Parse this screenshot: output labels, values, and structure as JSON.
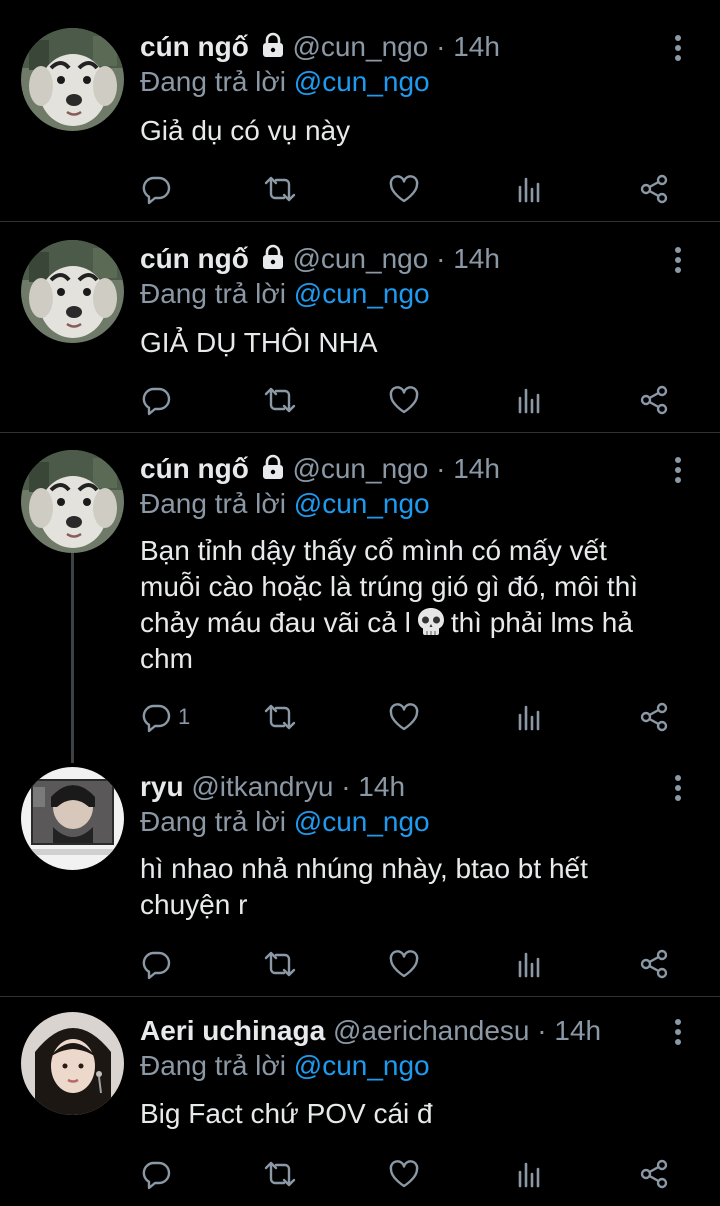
{
  "tweets": [
    {
      "name": "cún ngố",
      "handle": "@cun_ngo",
      "separator": "·",
      "time": "14h",
      "reply_label": "Đang trả lời",
      "reply_mention": "@cun_ngo",
      "text": "Giả dụ có vụ này",
      "reply_count": "",
      "avatar": "dog-avatar",
      "locked": true
    },
    {
      "name": "cún ngố",
      "handle": "@cun_ngo",
      "separator": "·",
      "time": "14h",
      "reply_label": "Đang trả lời",
      "reply_mention": "@cun_ngo",
      "text": "GIẢ DỤ THÔI NHA",
      "reply_count": "",
      "avatar": "dog-avatar",
      "locked": true
    },
    {
      "name": "cún ngố",
      "handle": "@cun_ngo",
      "separator": "·",
      "time": "14h",
      "reply_label": "Đang trả lời",
      "reply_mention": "@cun_ngo",
      "text_line1": "Bạn tỉnh dậy thấy cổ mình có mấy vết",
      "text_line2": "muỗi cào hoặc là trúng gió gì đó, môi thì",
      "text_line3a": "chảy máu đau vãi cả l",
      "text_line3b": "thì phải lms hả",
      "text_line4": "chm",
      "reply_count": "1",
      "avatar": "dog-avatar",
      "locked": true,
      "emoji": "skull-emoji"
    },
    {
      "name": "ryu",
      "handle": "@itkandryu",
      "separator": "·",
      "time": "14h",
      "reply_label": "Đang trả lời",
      "reply_mention": "@cun_ngo",
      "text_line1": "hì nhao nhả nhúng nhày, btao bt hết",
      "text_line2": "chuyện r",
      "reply_count": "",
      "avatar": "photo-avatar"
    },
    {
      "name": "Aeri uchinaga",
      "handle": "@aerichandesu",
      "separator": "·",
      "time": "14h",
      "reply_label": "Đang trả lời",
      "reply_mention": "@cun_ngo",
      "text": "Big Fact chứ POV cái đ",
      "reply_count": "",
      "avatar": "portrait-avatar"
    }
  ],
  "icons": {
    "reply": "reply-icon",
    "retweet": "retweet-icon",
    "like": "heart-icon",
    "views": "views-icon",
    "share": "share-icon",
    "more": "more-vertical-icon",
    "lock": "lock-icon"
  },
  "colors": {
    "background": "#000000",
    "text": "#e7e9ea",
    "muted": "#8b98a5",
    "link": "#1d9bf0",
    "divider": "#2f3336"
  }
}
